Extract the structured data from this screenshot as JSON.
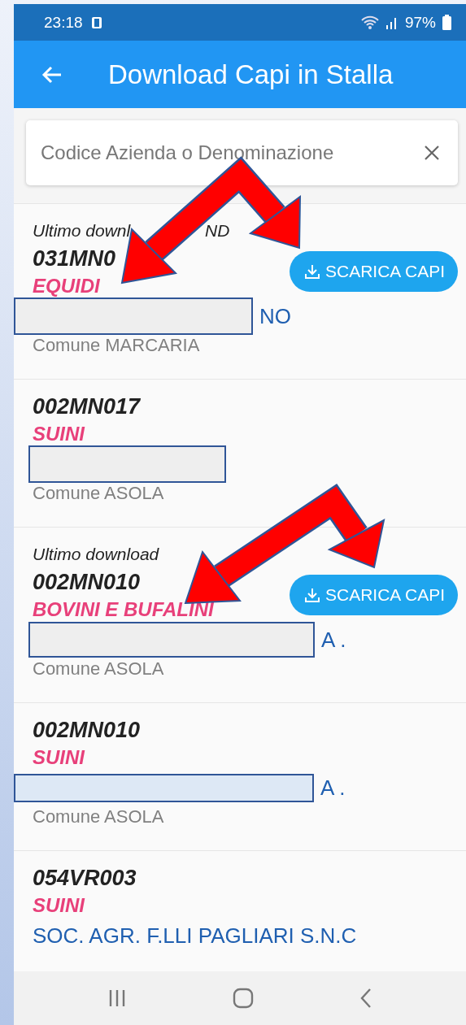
{
  "status_bar": {
    "time": "23:18",
    "battery": "97%"
  },
  "app_bar": {
    "title": "Download Capi in Stalla"
  },
  "search": {
    "placeholder": "Codice Azienda o Denominazione"
  },
  "farms": [
    {
      "last_download": [
        "Ultimo downl",
        "ND"
      ],
      "code": "031MN0",
      "species": "EQUIDI",
      "redacted": true,
      "name": "NO",
      "municipality": "Comune MARCARIA",
      "download_button": "SCARICA CAPI"
    },
    {
      "code": "002MN017",
      "species": "SUINI",
      "redacted": true,
      "municipality": "Comune ASOLA"
    },
    {
      "last_download": [
        "Ultimo download"
      ],
      "code": "002MN010",
      "species": "BOVINI E BUFALINI",
      "redacted": true,
      "name": "A .",
      "municipality": "Comune ASOLA",
      "download_button": "SCARICA CAPI"
    },
    {
      "code": "002MN010",
      "species": "SUINI",
      "redacted": true,
      "name": "A .",
      "municipality": "Comune ASOLA"
    },
    {
      "code": "054VR003",
      "species": "SUINI",
      "redacted": false,
      "name": "SOC. AGR. F.LLI PAGLIARI S.N.C"
    }
  ]
}
